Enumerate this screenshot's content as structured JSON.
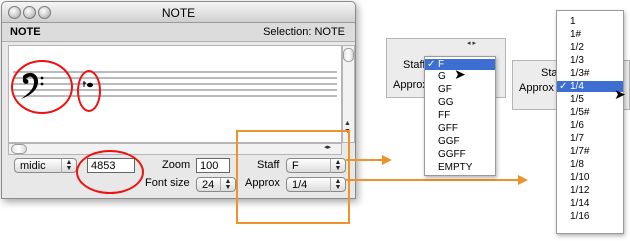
{
  "window": {
    "title": "NOTE",
    "header_left": "NOTE",
    "header_right": "Selection: NOTE"
  },
  "controls": {
    "mode_select": "midic",
    "value_field": "4853",
    "zoom_label": "Zoom",
    "zoom_value": "100",
    "fontsize_label": "Font size",
    "fontsize_value": "24",
    "staff_label": "Staff",
    "staff_value": "F",
    "approx_label": "Approx",
    "approx_value": "1/4"
  },
  "staff_popup": {
    "staff_label": "Staff",
    "approx_label": "Approx",
    "items": [
      "F",
      "G",
      "GF",
      "GG",
      "FF",
      "GFF",
      "GGF",
      "GGFF",
      "EMPTY"
    ],
    "selected": "F"
  },
  "approx_popup": {
    "staff_label": "Staff",
    "approx_label": "Approx",
    "items": [
      "1",
      "1#",
      "1/2",
      "1/3",
      "1/3#",
      "1/4",
      "1/5",
      "1/5#",
      "1/6",
      "1/7",
      "1/7#",
      "1/8",
      "1/10",
      "1/12",
      "1/14",
      "1/16"
    ],
    "selected": "1/4"
  },
  "colors": {
    "highlight": "#e11111",
    "callout": "#f0922b",
    "menu_selection": "#3c6fd1"
  }
}
